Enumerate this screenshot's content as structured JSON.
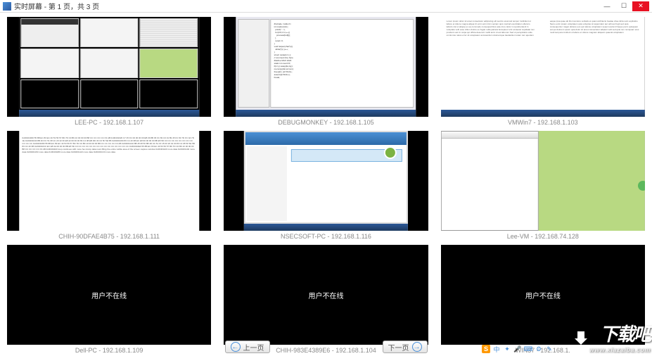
{
  "window": {
    "title": "实时屏幕 - 第 1 页，共 3 页"
  },
  "offline_text": "用户不在线",
  "cells": [
    {
      "label": "LEE-PC - 192.168.1.107"
    },
    {
      "label": "DEBUGMONKEY - 192.168.1.105"
    },
    {
      "label": "VMWin7 - 192.168.1.103"
    },
    {
      "label": "CHIH-90DFAE4B75 - 192.168.1.111"
    },
    {
      "label": "NSECSOFT-PC - 192.168.1.116"
    },
    {
      "label": "Lee-VM - 192.168.74.128"
    },
    {
      "label": "Dell-PC - 192.168.1.109"
    },
    {
      "label": "CHIH-983E4389E6 - 192.168.1.104"
    },
    {
      "label": "WIN37 - 192.168.1."
    }
  ],
  "nav": {
    "prev": "上一页",
    "next": "下一页"
  },
  "watermark": {
    "brand": "下载吧",
    "url": "www.xiazaiba.com"
  },
  "tray": {
    "sogou": "S"
  }
}
